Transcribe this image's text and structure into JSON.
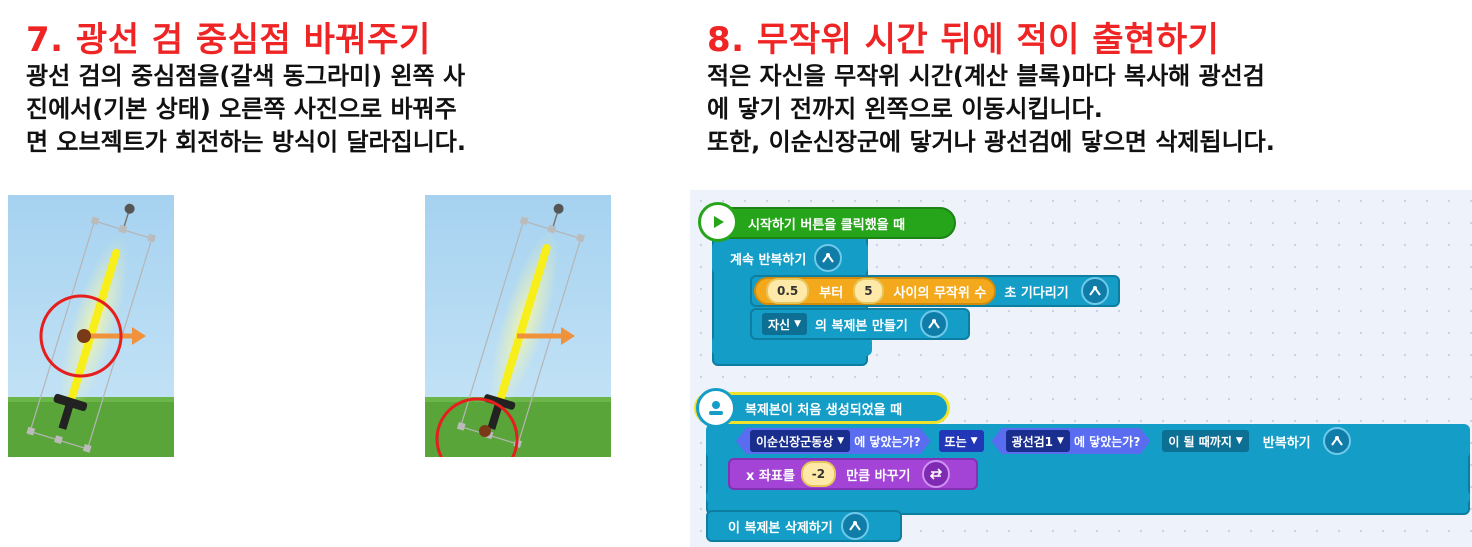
{
  "left": {
    "title": "7. 광선 검 중심점 바꿔주기",
    "lines": [
      "광선 검의 중심점을(갈색 동그라미) 왼쪽 사",
      "진에서(기본 상태) 오른쪽 사진으로 바꿔주",
      "면 오브젝트가 회전하는 방식이 달라집니다."
    ]
  },
  "right": {
    "title": "8. 무작위 시간 뒤에 적이 출현하기",
    "lines": [
      "적은 자신을 무작위 시간(계산 블록)마다 복사해 광선검",
      "에 닿기 전까지 왼쪽으로 이동시킵니다.",
      "또한, 이순신장군에 닿거나 광선검에 닿으면 삭제됩니다."
    ]
  },
  "colors": {
    "title_red": "#ef2525",
    "flow_blue": "#139dc7",
    "start_green": "#26a51b",
    "calc_orange": "#f4a91c",
    "move_purple": "#a444d6",
    "judge_blue": "#2f4bd6"
  },
  "code": {
    "script1": {
      "event_label": "시작하기 버튼을 클릭했을 때",
      "event_icon": "play-icon",
      "loop_label": "계속 반복하기",
      "wait": {
        "from_value": "0.5",
        "from_label": "부터",
        "to_value": "5",
        "random_label": "사이의 무작위 수",
        "suffix": "초 기다리기"
      },
      "clone": {
        "target": "자신",
        "label": "의 복제본 만들기"
      }
    },
    "script2": {
      "event_label": "복제본이 처음 생성되었을 때",
      "event_icon": "person-icon",
      "repeat": {
        "cond1_target": "이순신장군동상",
        "cond1_label": "에 닿았는가?",
        "or_label": "또는",
        "cond2_target": "광선검1",
        "cond2_label": "에 닿았는가?",
        "until_label": "이 될 때까지",
        "suffix": "반복하기"
      },
      "move": {
        "label": "x 좌표를",
        "value": "-2",
        "suffix": "만큼 바꾸기"
      },
      "delete_label": "이 복제본 삭제하기"
    }
  }
}
